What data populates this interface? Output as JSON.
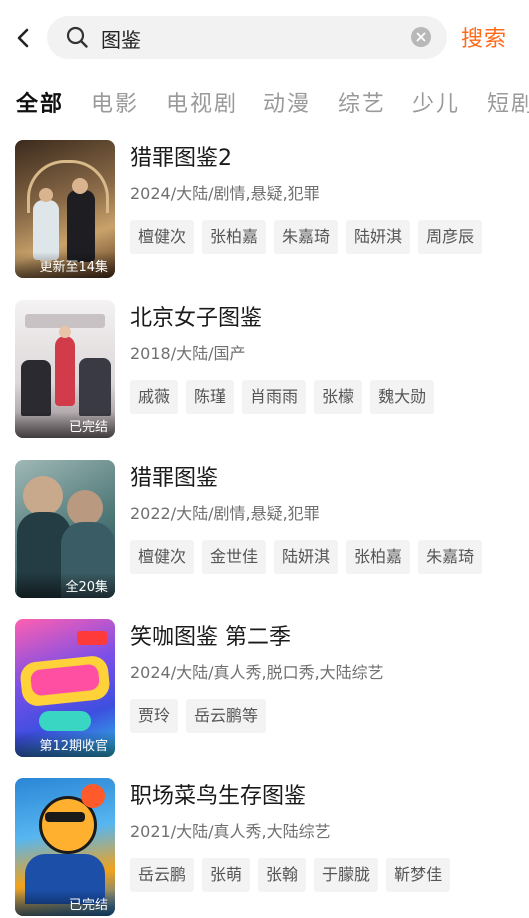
{
  "search": {
    "query": "图鉴",
    "button_label": "搜索"
  },
  "tabs": [
    {
      "label": "全部",
      "active": true
    },
    {
      "label": "电影",
      "active": false
    },
    {
      "label": "电视剧",
      "active": false
    },
    {
      "label": "动漫",
      "active": false
    },
    {
      "label": "综艺",
      "active": false
    },
    {
      "label": "少儿",
      "active": false
    },
    {
      "label": "短剧",
      "active": false
    }
  ],
  "results": [
    {
      "title": "猎罪图鉴2",
      "meta": "2024/大陆/剧情,悬疑,犯罪",
      "status": "更新至14集",
      "tags": [
        "檀健次",
        "张柏嘉",
        "朱嘉琦",
        "陆妍淇",
        "周彦辰"
      ],
      "poster_colors": [
        "#5a3a22",
        "#c9a26a"
      ]
    },
    {
      "title": "北京女子图鉴",
      "meta": "2018/大陆/国产",
      "status": "已完结",
      "tags": [
        "戚薇",
        "陈瑾",
        "肖雨雨",
        "张檬",
        "魏大勋"
      ],
      "poster_colors": [
        "#e8e6e6",
        "#9a8f94"
      ]
    },
    {
      "title": "猎罪图鉴",
      "meta": "2022/大陆/剧情,悬疑,犯罪",
      "status": "全20集",
      "tags": [
        "檀健次",
        "金世佳",
        "陆妍淇",
        "张柏嘉",
        "朱嘉琦"
      ],
      "poster_colors": [
        "#1f4a52",
        "#6b8f8f"
      ]
    },
    {
      "title": "笑咖图鉴 第二季",
      "meta": "2024/大陆/真人秀,脱口秀,大陆综艺",
      "status": "第12期收官",
      "tags": [
        "贾玲",
        "岳云鹏等"
      ],
      "poster_colors": [
        "#3d4fe0",
        "#ff4fa3"
      ]
    },
    {
      "title": "职场菜鸟生存图鉴",
      "meta": "2021/大陆/真人秀,大陆综艺",
      "status": "已完结",
      "tags": [
        "岳云鹏",
        "张萌",
        "张翰",
        "于朦胧",
        "靳梦佳"
      ],
      "poster_colors": [
        "#f2a21c",
        "#2a86d6"
      ]
    }
  ]
}
